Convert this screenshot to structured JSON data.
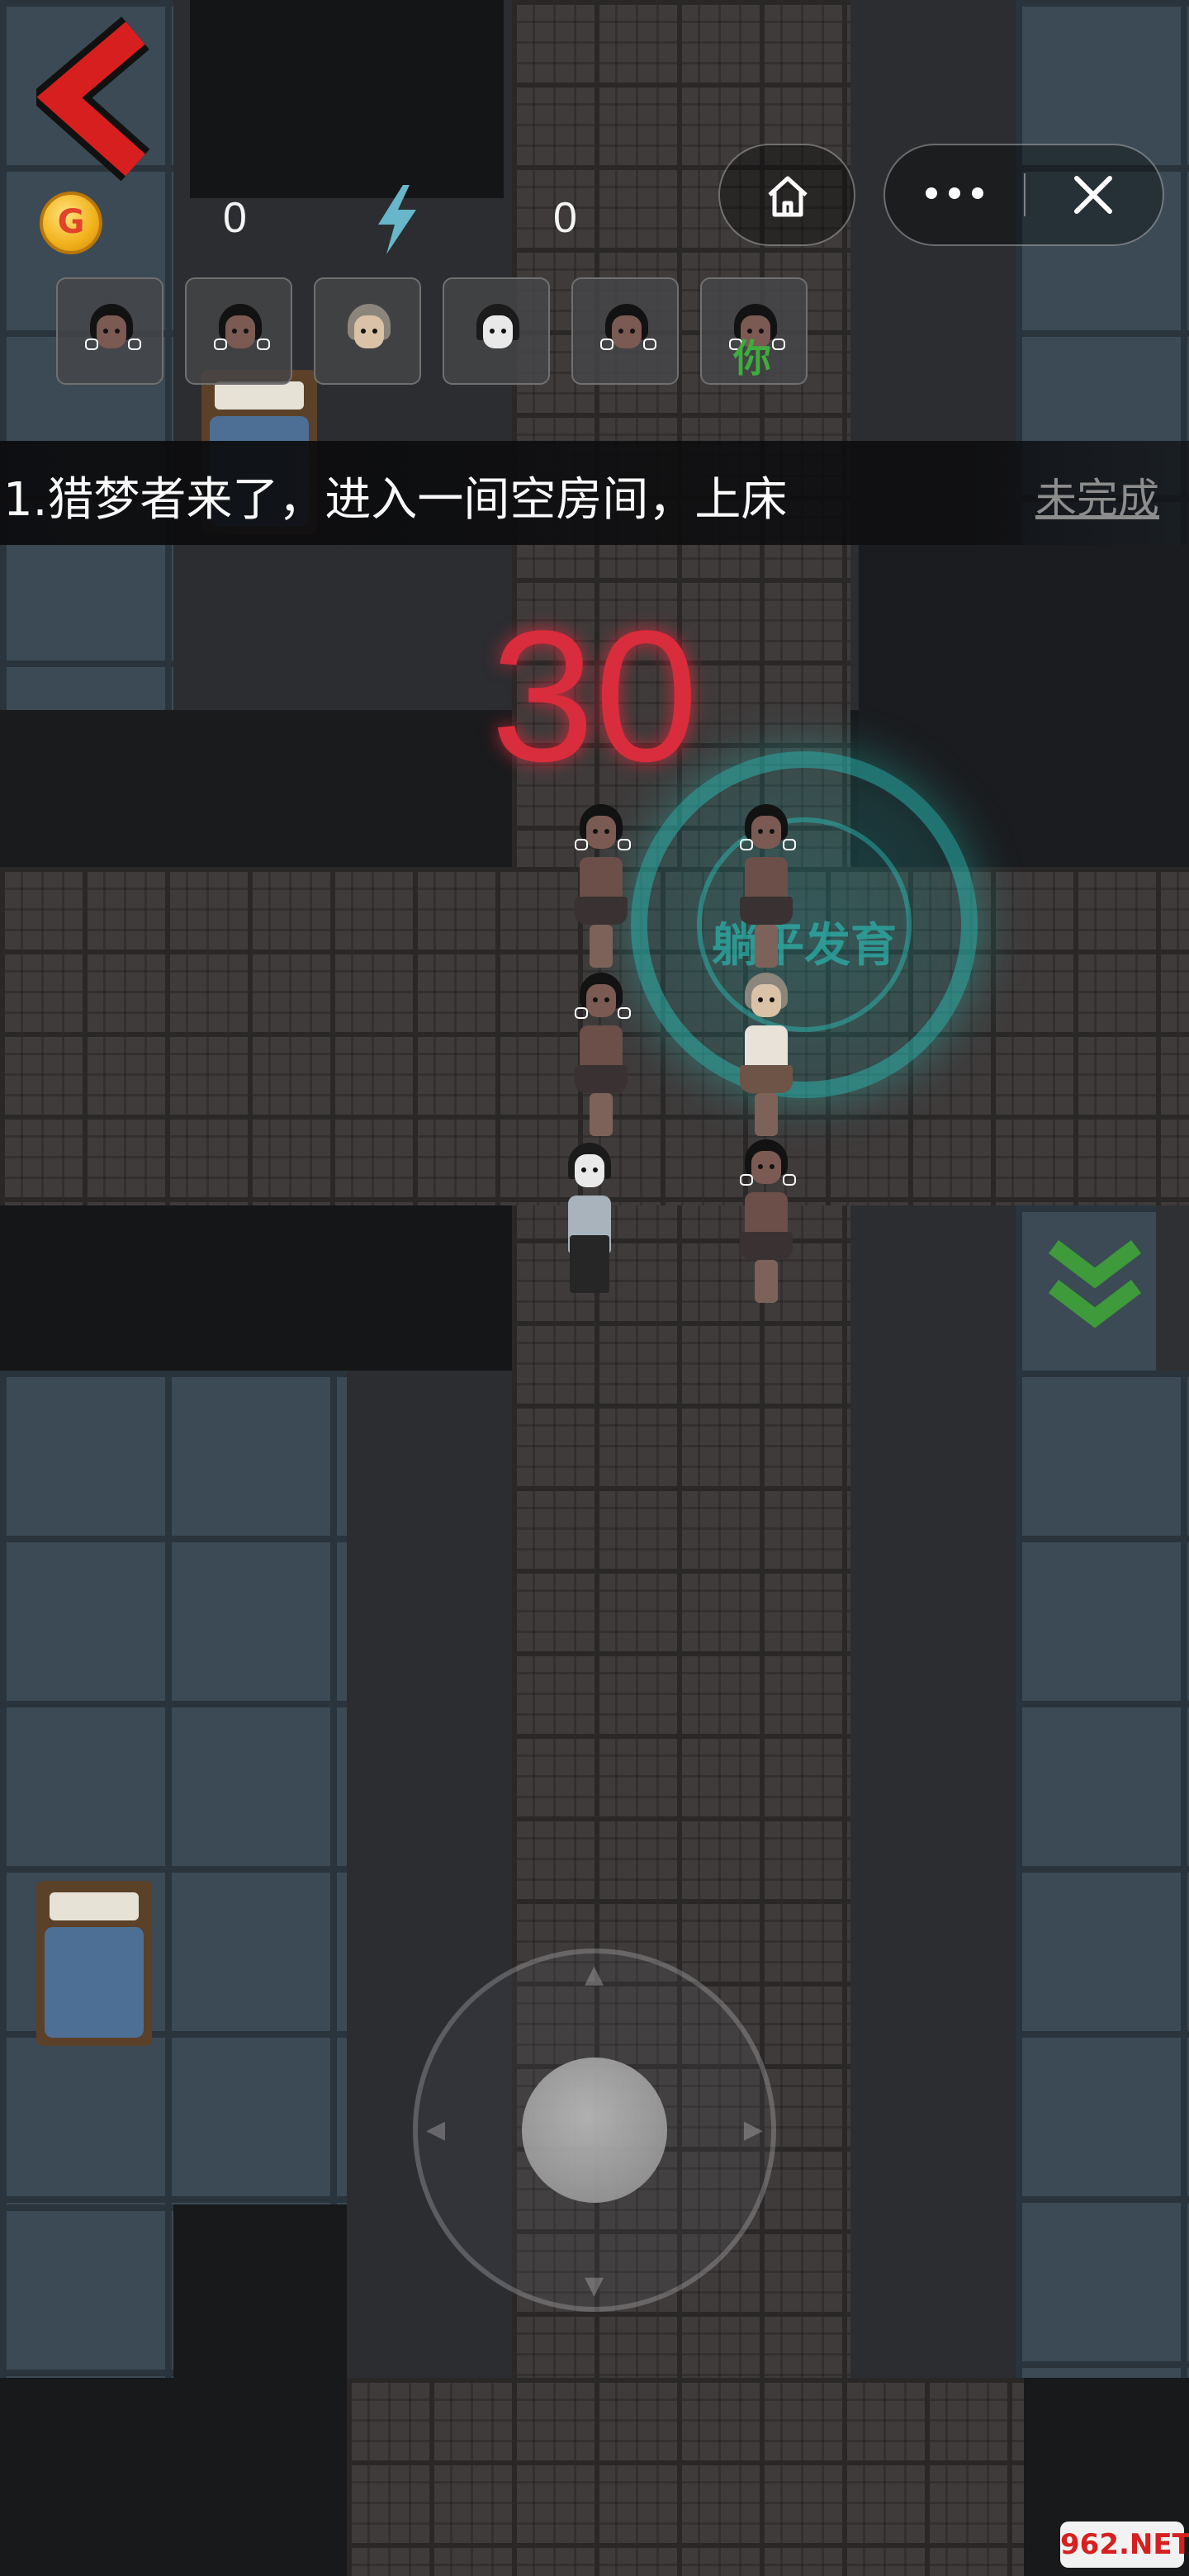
{
  "hud": {
    "coins": "0",
    "energy": "0",
    "coin_icon_glyph": "G",
    "you_label": "你"
  },
  "task": {
    "text": "1.猎梦者来了，进入一间空房间，上床",
    "status": "未完成"
  },
  "timer": "30",
  "players": [
    {
      "type": "girl",
      "is_you": false
    },
    {
      "type": "girl",
      "is_you": false
    },
    {
      "type": "granny",
      "is_you": false
    },
    {
      "type": "boy",
      "is_you": false
    },
    {
      "type": "girl",
      "is_you": false
    },
    {
      "type": "girl",
      "is_you": true
    }
  ],
  "seal_text": "躺平发育",
  "watermark": "962.NET",
  "icons": {
    "back": "back-arrow-icon",
    "coin": "gold-coin-icon",
    "energy": "lightning-icon",
    "home": "home-icon",
    "more": "more-dots-icon",
    "close": "close-icon",
    "exit": "double-chevron-down-icon"
  },
  "colors": {
    "timer": "#d92c3c",
    "back_arrow": "#d81f1f",
    "you_label": "#3eac3e",
    "exit_marker": "#3e9a3a",
    "seal": "#28c8be"
  }
}
